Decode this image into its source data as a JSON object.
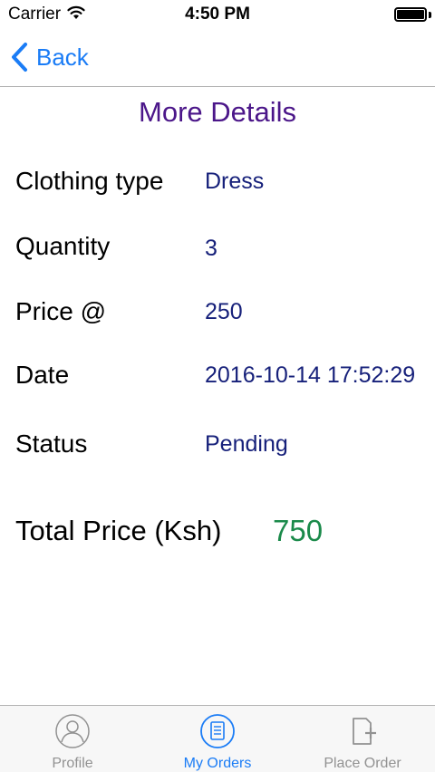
{
  "status_bar": {
    "carrier": "Carrier",
    "time": "4:50 PM",
    "wifi_icon": "wifi-icon",
    "battery_icon": "battery-icon"
  },
  "nav": {
    "back_label": "Back",
    "back_icon": "chevron-left-icon"
  },
  "page": {
    "title": "More Details"
  },
  "details": [
    {
      "label": "Clothing type",
      "value": "Dress"
    },
    {
      "label": "Quantity",
      "value": "3"
    },
    {
      "label": "Price @",
      "value": "250"
    },
    {
      "label": "Date",
      "value": "2016-10-14 17:52:29"
    },
    {
      "label": "Status",
      "value": "Pending"
    }
  ],
  "total": {
    "label": "Total Price (Ksh)",
    "value": "750"
  },
  "tabs": [
    {
      "label": "Profile",
      "icon": "person-icon",
      "active": false
    },
    {
      "label": "My Orders",
      "icon": "orders-list-icon",
      "active": true
    },
    {
      "label": "Place Order",
      "icon": "add-document-icon",
      "active": false
    }
  ],
  "colors": {
    "accent": "#1a7cf6",
    "title": "#4b1689",
    "value_text": "#16207a",
    "total_value": "#1a8a4a",
    "tab_inactive": "#929292"
  }
}
